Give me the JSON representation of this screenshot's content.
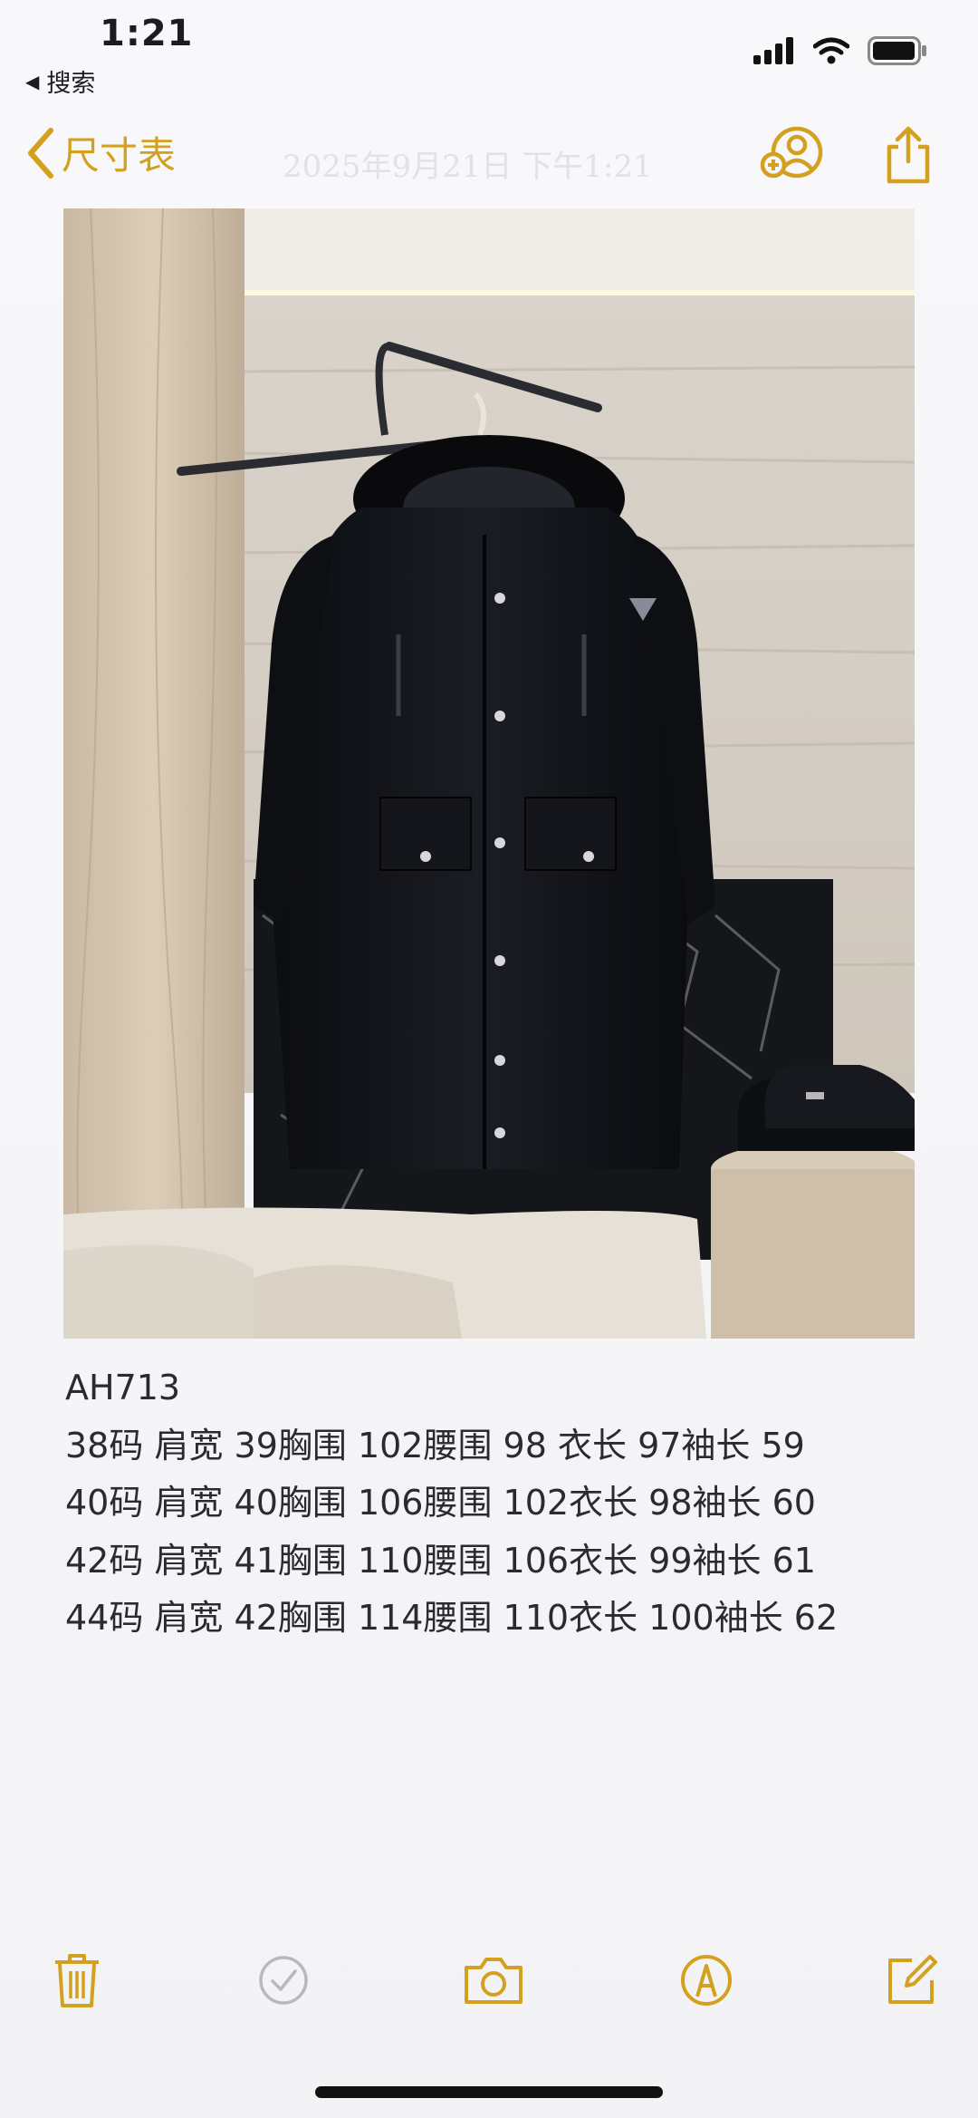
{
  "status_bar": {
    "time": "1:21",
    "back_label": "搜索",
    "icons": [
      "signal-icon",
      "wifi-icon",
      "battery-icon"
    ]
  },
  "nav": {
    "back_label": "尺寸表",
    "date_text": "2025年9月21日 下午1:21",
    "icons": [
      "add-person-icon",
      "share-icon"
    ]
  },
  "photo": {
    "subject": "black hooded long down coat on hanger"
  },
  "note": {
    "lines": [
      "AH713",
      "38码 肩宽 39胸围 102腰围 98 衣长 97袖长 59",
      "40码 肩宽 40胸围 106腰围 102衣长 98袖长 60",
      "42码 肩宽 41胸围 110腰围 106衣长 99袖长 61",
      "44码 肩宽 42胸围 114腰围 110衣长 100袖长 62"
    ]
  },
  "toolbar": {
    "icons": [
      "trash-icon",
      "checklist-icon",
      "camera-icon",
      "markup-icon",
      "compose-icon"
    ]
  },
  "colors": {
    "accent": "#d4a020",
    "background": "#f6f6f8",
    "text": "#2b2b2d"
  }
}
